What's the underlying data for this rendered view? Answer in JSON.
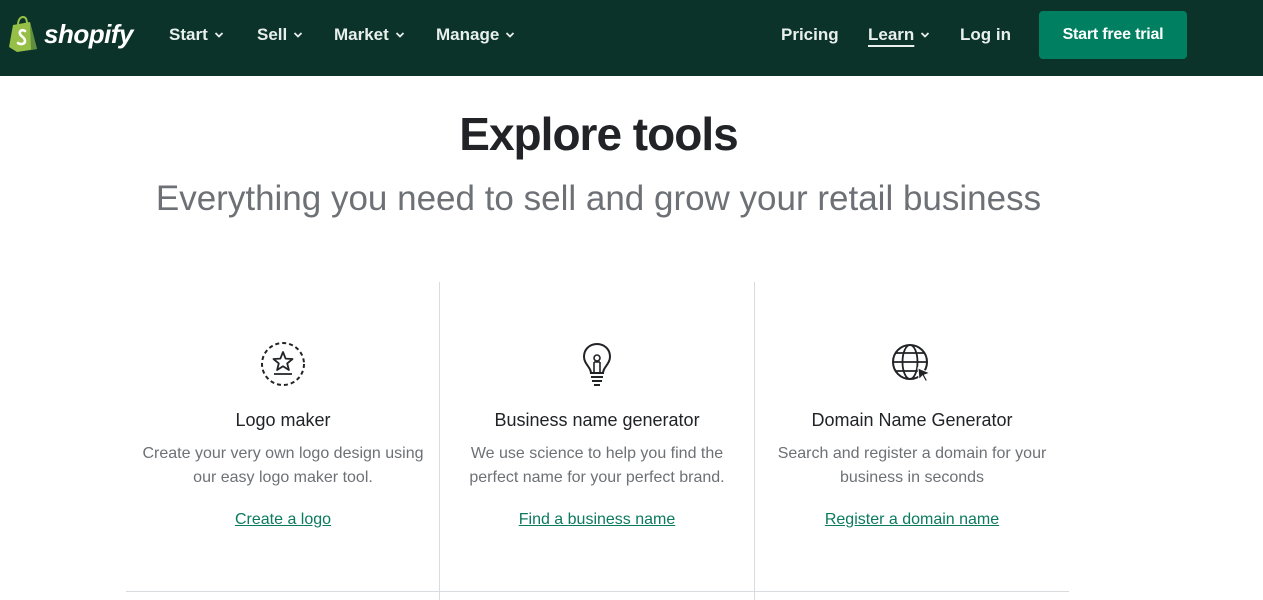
{
  "nav": {
    "brand": "shopify",
    "items": [
      {
        "label": "Start"
      },
      {
        "label": "Sell"
      },
      {
        "label": "Market"
      },
      {
        "label": "Manage"
      }
    ],
    "pricing": "Pricing",
    "learn": "Learn",
    "login": "Log in",
    "cta": "Start free trial"
  },
  "hero": {
    "title": "Explore tools",
    "subtitle": "Everything you need to sell and grow your retail business"
  },
  "tools": [
    {
      "icon": "star-badge-icon",
      "title": "Logo maker",
      "description": "Create your very own logo design using our easy logo maker tool.",
      "link": "Create a logo"
    },
    {
      "icon": "lightbulb-icon",
      "title": "Business name generator",
      "description": "We use science to help you find the perfect name for your perfect brand.",
      "link": "Find a business name"
    },
    {
      "icon": "globe-cursor-icon",
      "title": "Domain Name Generator",
      "description": "Search and register a domain for your business in seconds",
      "link": "Register a domain name"
    }
  ],
  "colors": {
    "nav_bg": "#0b3329",
    "cta_bg": "#008060",
    "link": "#0b7a5e"
  }
}
